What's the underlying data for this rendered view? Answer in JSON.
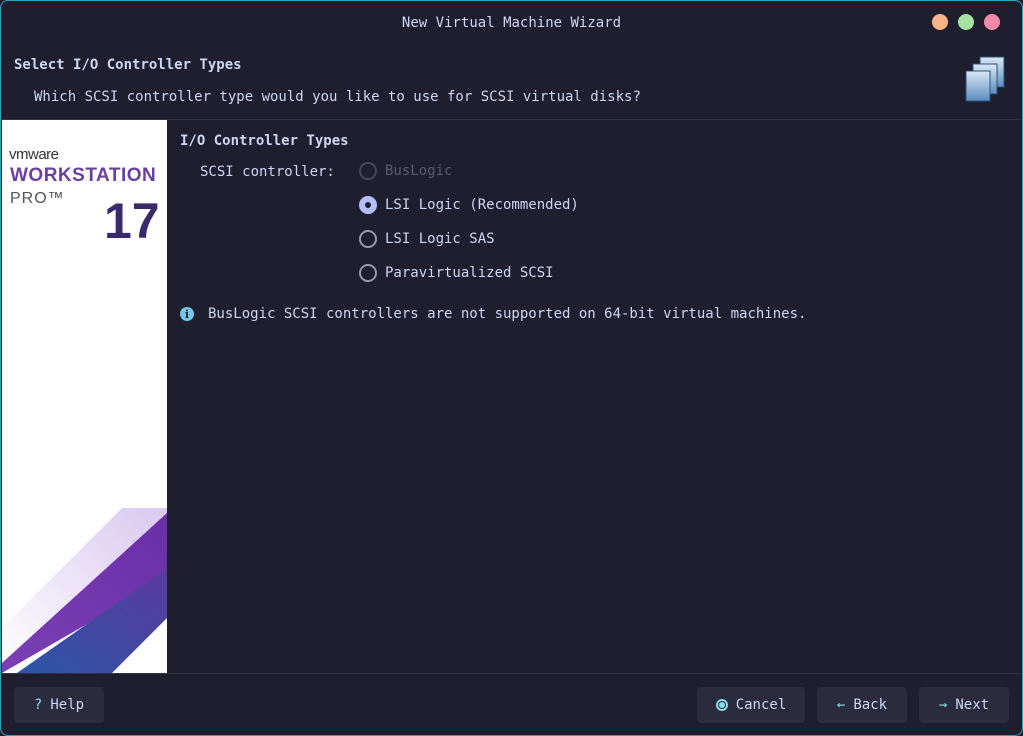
{
  "window": {
    "title": "New Virtual Machine Wizard"
  },
  "header": {
    "title": "Select I/O Controller Types",
    "subtitle": "Which SCSI controller type would you like to use for SCSI virtual disks?"
  },
  "brand": {
    "vendor": "vmware",
    "product": "WORKSTATION",
    "edition": "PRO™",
    "version": "17"
  },
  "content": {
    "section_title": "I/O Controller Types",
    "field_label": "SCSI controller:",
    "options": [
      {
        "label": "BusLogic",
        "state": "disabled"
      },
      {
        "label": "LSI Logic (Recommended)",
        "state": "checked"
      },
      {
        "label": "LSI Logic SAS",
        "state": "unchecked"
      },
      {
        "label": "Paravirtualized SCSI",
        "state": "unchecked"
      }
    ],
    "info_text": "BusLogic SCSI controllers are not supported on 64-bit virtual machines."
  },
  "footer": {
    "help": "Help",
    "cancel": "Cancel",
    "back": "Back",
    "next": "Next"
  },
  "icons": {
    "help": "question-icon",
    "cancel": "cancel-icon",
    "back": "arrow-left-icon",
    "next": "arrow-right-icon",
    "info": "info-icon",
    "header": "virtual-machine-icon"
  },
  "colors": {
    "background": "#1e1e2e",
    "accent": "#89dceb",
    "window_border": "#2aa3b5",
    "brand_purple": "#6b3fa0"
  }
}
